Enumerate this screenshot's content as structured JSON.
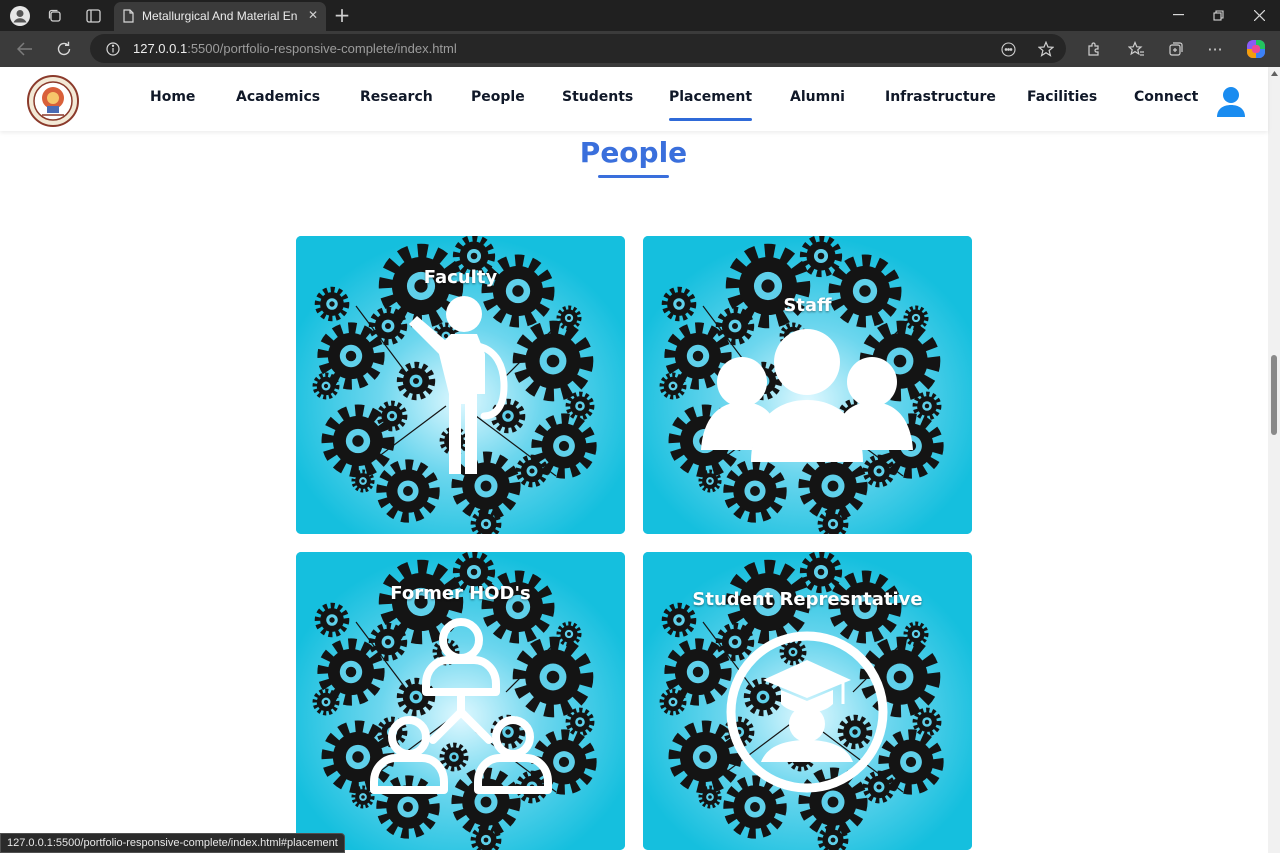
{
  "browser": {
    "tab_title": "Metallurgical And Material Engine",
    "url_host": "127.0.0.1",
    "url_rest": ":5500/portfolio-responsive-complete/index.html",
    "status_url": "127.0.0.1:5500/portfolio-responsive-complete/index.html#placement"
  },
  "nav": {
    "items": [
      "Home",
      "Academics",
      "Research",
      "People",
      "Students",
      "Placement",
      "Alumni",
      "Infrastructure",
      "Facilities",
      "Connect"
    ],
    "active": "Placement",
    "accent": "#2f6ad8"
  },
  "section": {
    "title": "People",
    "color": "#3a6fdc"
  },
  "cards": [
    {
      "label": "Faculty",
      "icon": "teacher-pointing-icon"
    },
    {
      "label": "Staff",
      "icon": "group-icon"
    },
    {
      "label": "Former HOD's",
      "icon": "hierarchy-people-icon"
    },
    {
      "label": "Student Represntative",
      "icon": "graduate-student-icon"
    }
  ],
  "colors": {
    "card_bg": "#15bfde",
    "gear": "#141414"
  }
}
